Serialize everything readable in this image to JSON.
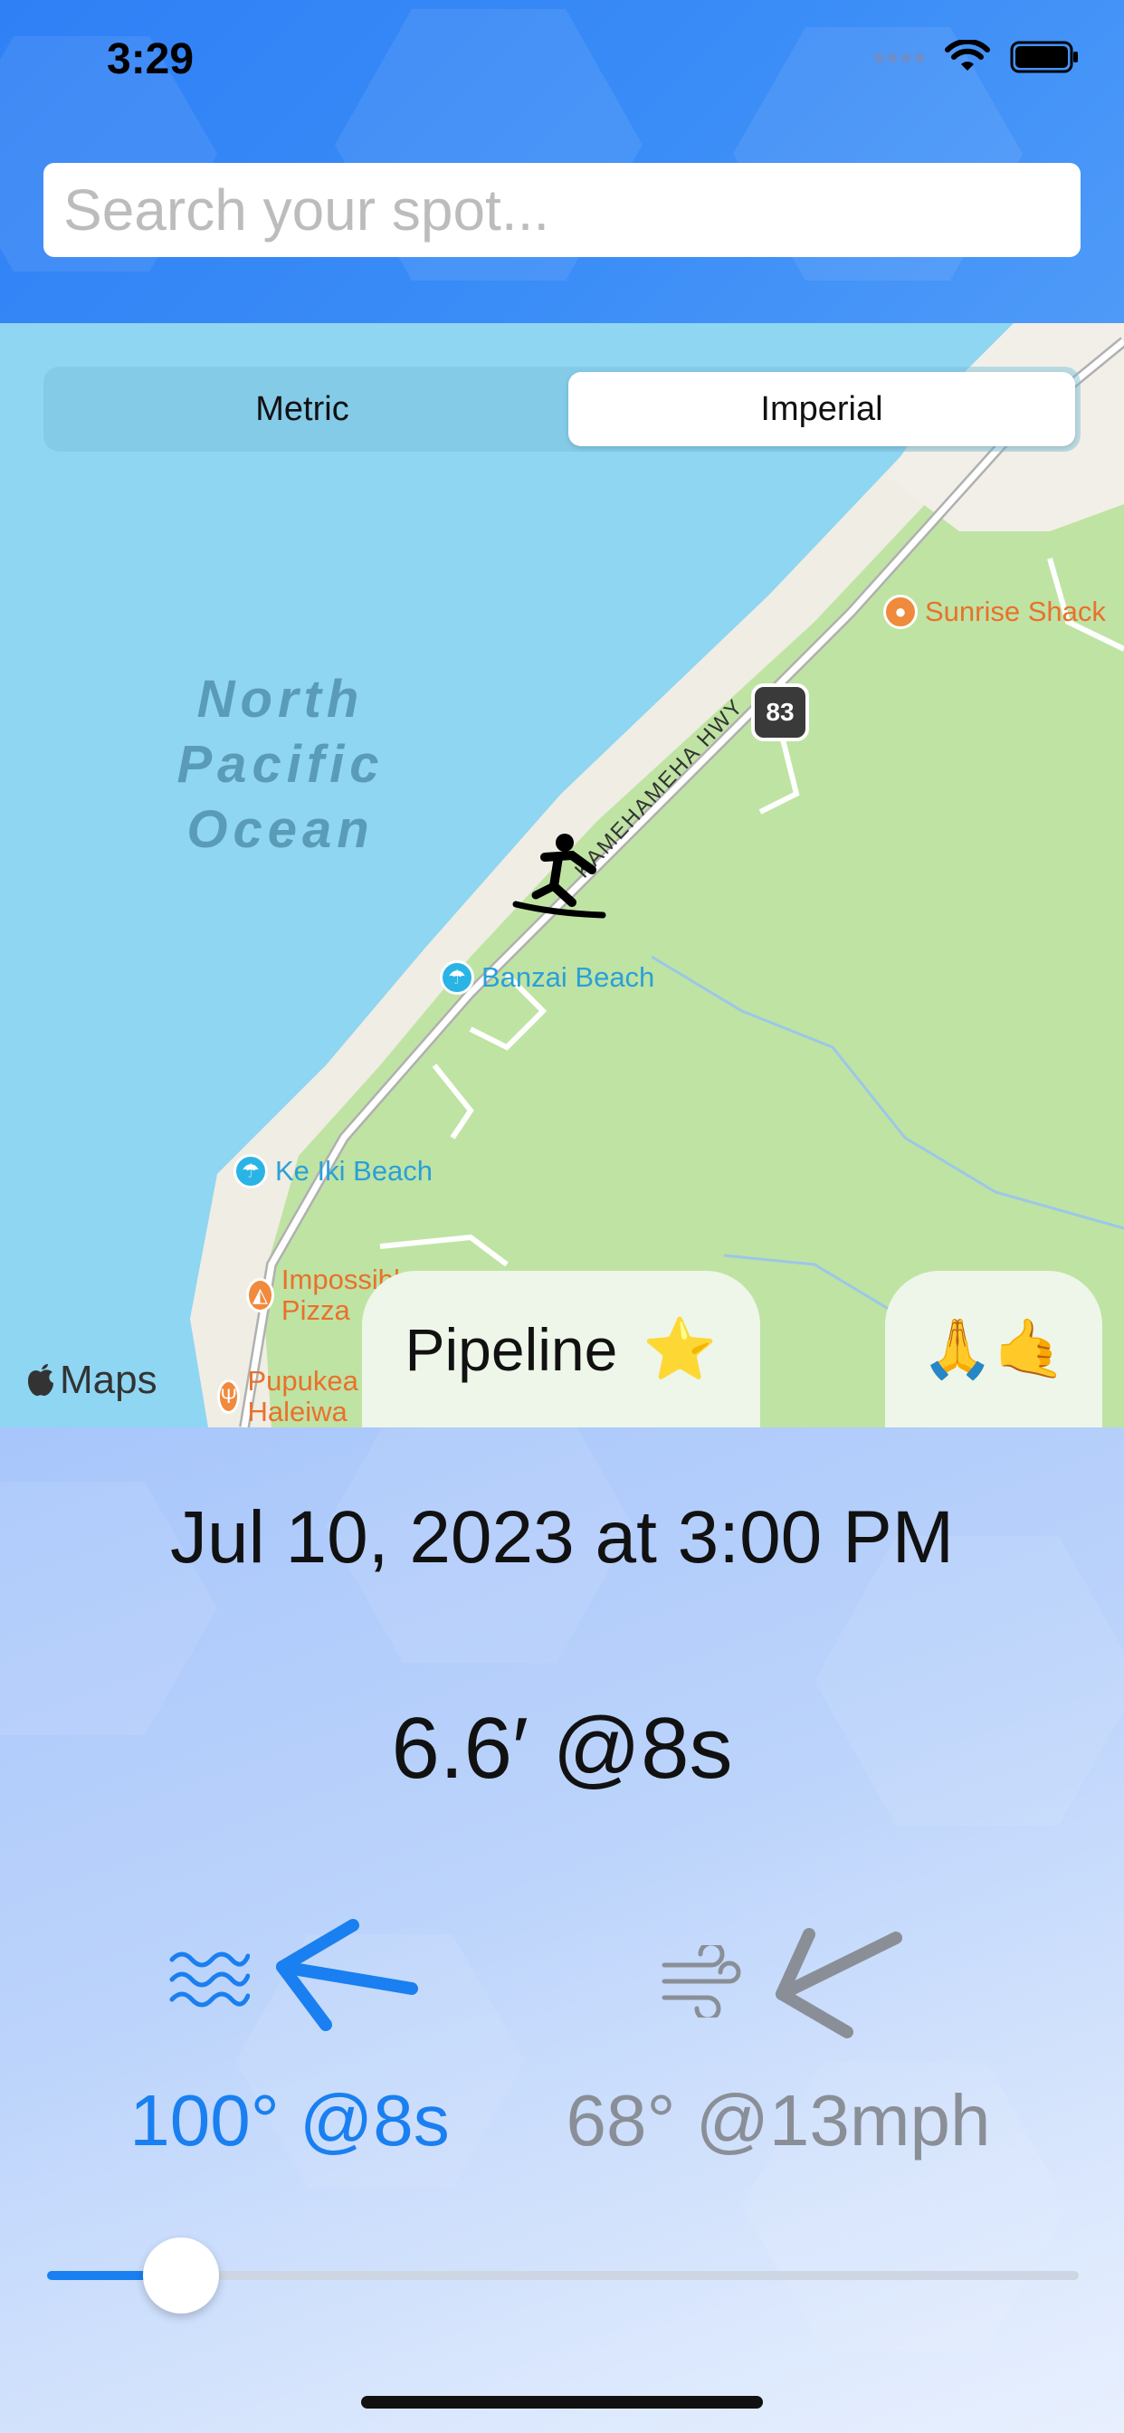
{
  "status_bar": {
    "time": "3:29"
  },
  "search": {
    "placeholder": "Search your spot..."
  },
  "units": {
    "options": [
      "Metric",
      "Imperial"
    ],
    "selected": "Imperial"
  },
  "map": {
    "ocean_label": "North Pacific Ocean",
    "highway_label": "KAMEHAMEHA HWY",
    "route_shield": "83",
    "pois": {
      "sunrise_shack": "Sunrise Shack",
      "banzai_beach": "Banzai Beach",
      "ke_iki_beach": "Ke Iki Beach",
      "impossible_pizza": "Impossible Pizza",
      "pupukea_haleiwa": "Pupukea Haleiwa"
    },
    "attribution": "Maps",
    "spot_name": "Pipeline",
    "favorite_icon": "⭐",
    "reaction_emojis": "🙏🤙"
  },
  "forecast": {
    "datetime": "Jul 10, 2023 at 3:00 PM",
    "wave_height": "6.6′ @8s",
    "swell": "100° @8s",
    "wind": "68° @13mph",
    "swell_color": "#1a7ff0",
    "wind_color": "#8a8f97"
  },
  "time_slider": {
    "value": 0.13
  },
  "icons": {
    "swell": "waves-icon",
    "swell_direction": "arrow-left-icon",
    "wind": "wind-icon",
    "wind_direction": "arrow-down-left-icon",
    "surfer": "surfer-icon"
  }
}
